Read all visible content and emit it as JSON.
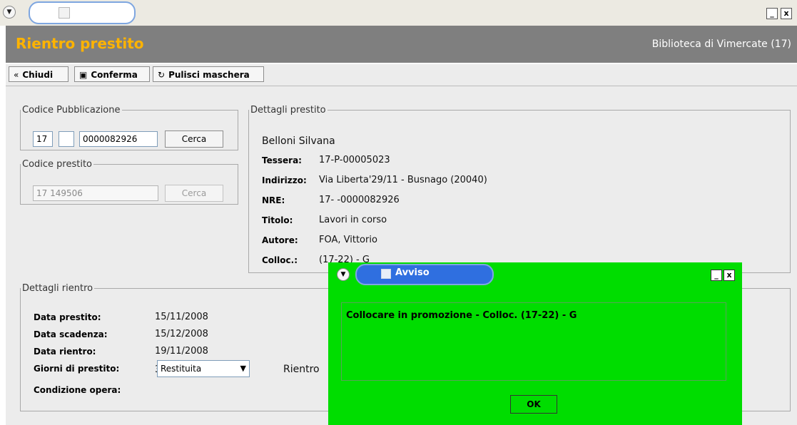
{
  "window": {
    "menu_icon": "chevron-down-icon",
    "minimize_label": "_",
    "close_label": "x"
  },
  "header": {
    "title": "Rientro prestito",
    "org": "Biblioteca di Vimercate (17)"
  },
  "toolbar": {
    "close_label": "Chiudi",
    "confirm_label": "Conferma",
    "clear_label": "Pulisci maschera"
  },
  "codice_pubblicazione": {
    "legend": "Codice Pubblicazione",
    "field1": "17",
    "field2": "",
    "field3": "0000082926",
    "search_label": "Cerca"
  },
  "codice_prestito": {
    "legend": "Codice prestito",
    "value": "17 149506",
    "search_label": "Cerca"
  },
  "dettagli_prestito": {
    "legend": "Dettagli prestito",
    "name": "Belloni Silvana",
    "rows": [
      {
        "label": "Tessera:",
        "value": "17-P-00005023"
      },
      {
        "label": "Indirizzo:",
        "value": "Via Liberta'29/11 - Busnago (20040)"
      },
      {
        "label": "NRE:",
        "value": "17- -0000082926"
      },
      {
        "label": "Titolo:",
        "value": "Lavori in corso"
      },
      {
        "label": "Autore:",
        "value": "FOA, Vittorio"
      },
      {
        "label": "Colloc.:",
        "value": "(17-22) - G"
      }
    ]
  },
  "dettagli_rientro": {
    "legend": "Dettagli rientro",
    "rows": [
      {
        "label": "Data prestito:",
        "value": "15/11/2008"
      },
      {
        "label": "Data scadenza:",
        "value": "15/12/2008"
      },
      {
        "label": "Data rientro:",
        "value": "19/11/2008"
      },
      {
        "label": "Giorni di prestito:",
        "value": "3"
      }
    ],
    "condizione_label": "Condizione opera:",
    "condizione_value": "Restituita",
    "rientro_label": "Rientro"
  },
  "dialog": {
    "title": "Avviso",
    "message": "Collocare in promozione - Colloc. (17-22) - G",
    "ok_label": "OK"
  }
}
